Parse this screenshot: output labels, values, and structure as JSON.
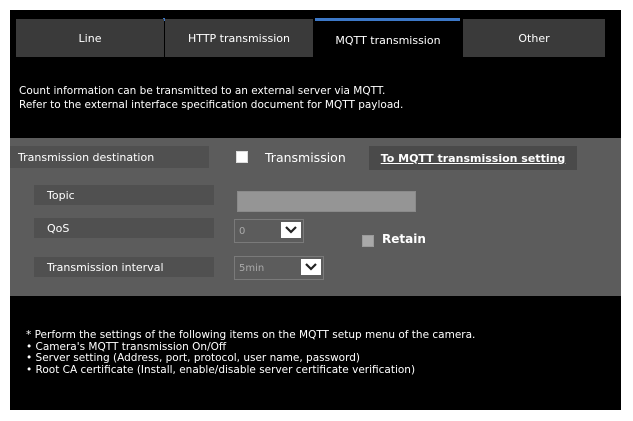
{
  "tabs": [
    {
      "label": "Line"
    },
    {
      "label": "HTTP transmission"
    },
    {
      "label": "MQTT transmission"
    },
    {
      "label": "Other"
    }
  ],
  "active_tab": "MQTT transmission",
  "description": {
    "line1": "Count information can be transmitted to an external server via MQTT.",
    "line2": "Refer to the external interface specification document for MQTT payload."
  },
  "form": {
    "destination_label": "Transmission destination",
    "transmission_checkbox_label": "Transmission",
    "transmission_checked": false,
    "mqtt_setting_link": "To MQTT transmission setting",
    "topic_label": "Topic",
    "topic_value": "",
    "qos_label": "QoS",
    "qos_value": "0",
    "retain_label": "Retain",
    "retain_checked": false,
    "interval_label": "Transmission interval",
    "interval_value": "5min"
  },
  "notes": {
    "line1": "* Perform the settings of the following items on the MQTT setup menu of the camera.",
    "line2": "• Camera's MQTT transmission On/Off",
    "line3": "• Server setting (Address, port, protocol, user name, password)",
    "line4": "• Root CA certificate (Install, enable/disable server certificate verification)"
  },
  "colors": {
    "background": "#000000",
    "panel": "#5c5c5c",
    "tab_inactive": "#3a3a3a",
    "tab_accent": "#3c78c8"
  }
}
